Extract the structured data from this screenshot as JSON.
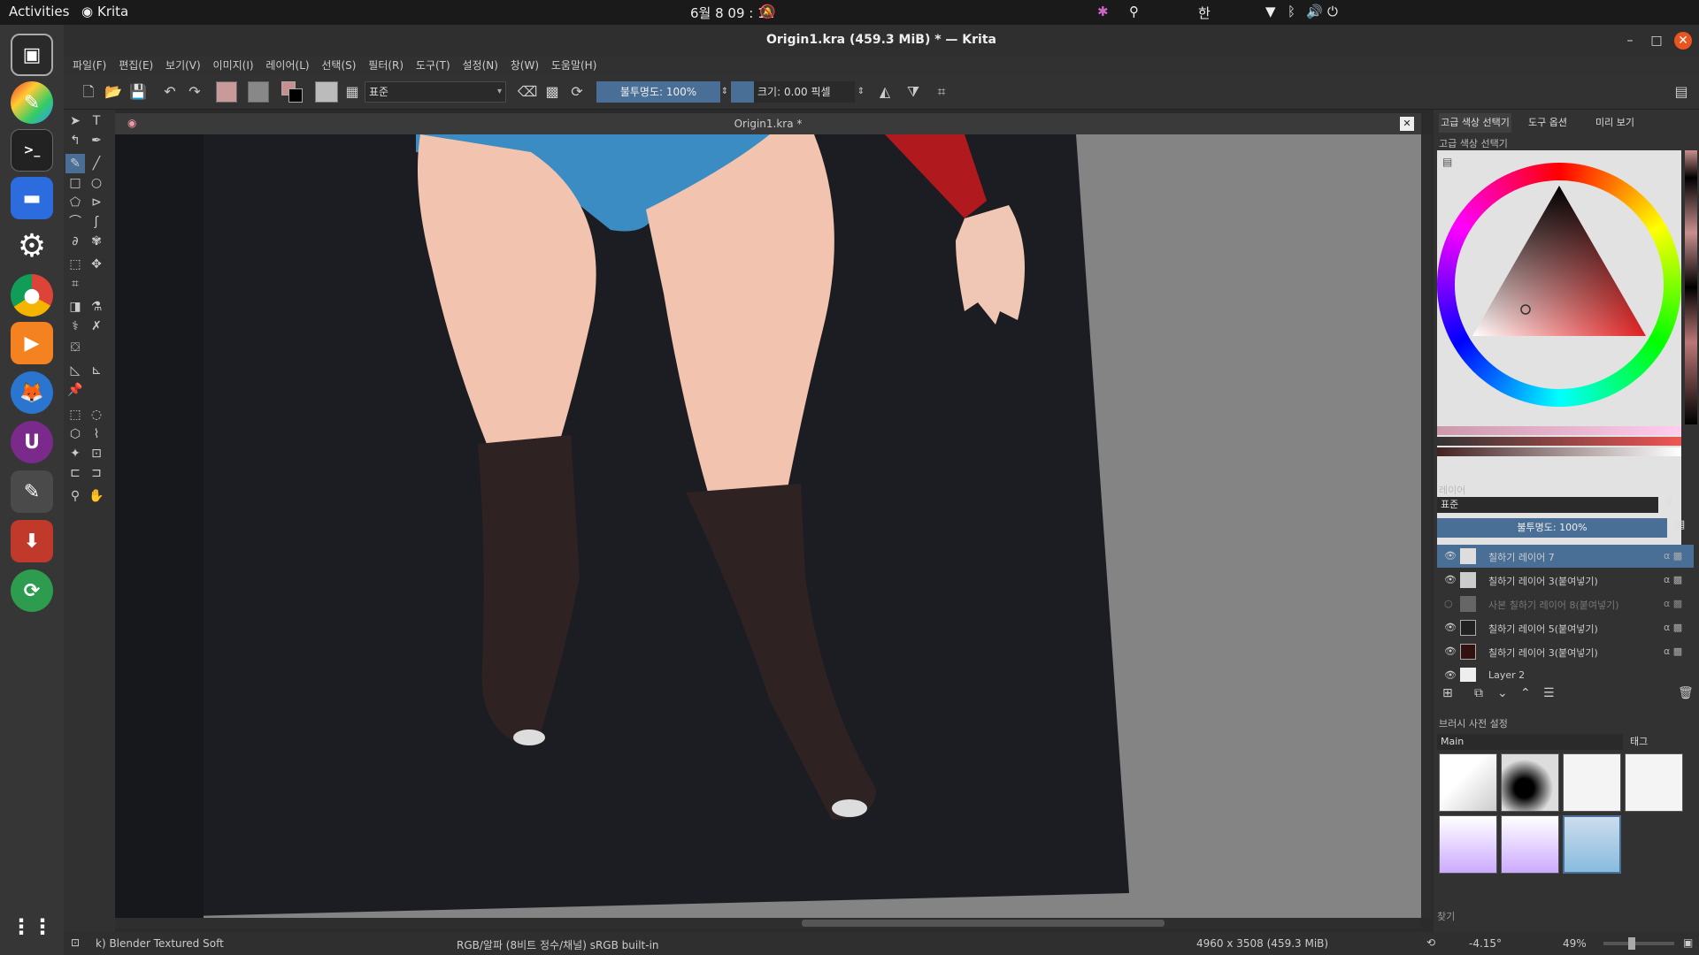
{
  "topbar": {
    "activities": "Activities",
    "app": "Krita",
    "clock": "6월 8  09 : 11",
    "ime": "한"
  },
  "window": {
    "title": "Origin1.kra (459.3 MiB)  * — Krita"
  },
  "menu": [
    "파일(F)",
    "편집(E)",
    "보기(V)",
    "이미지(I)",
    "레이어(L)",
    "선택(S)",
    "필터(R)",
    "도구(T)",
    "설정(N)",
    "창(W)",
    "도움말(H)"
  ],
  "toolbar": {
    "blend_mode": "표준",
    "opacity": "불투명도: 100%",
    "size": "크기: 0.00 픽셀"
  },
  "document_tab": "Origin1.kra *",
  "right_tabs": [
    "고급 색상 선택기",
    "도구 옵션",
    "미리 보기"
  ],
  "color_panel": {
    "title": "고급 색상 선택기"
  },
  "layers_panel": {
    "title": "레이어",
    "blend_mode": "표준",
    "opacity": "불투명도: 100%",
    "layers": [
      {
        "name": "칠하기 레이어 7",
        "visible": true,
        "selected": true
      },
      {
        "name": "칠하기 레이어 3(붙여넣기)",
        "visible": true,
        "selected": false
      },
      {
        "name": "사본 칠하기 레이어 8(붙여넣기)",
        "visible": false,
        "selected": false
      },
      {
        "name": "칠하기 레이어 5(붙여넣기)",
        "visible": true,
        "selected": false
      },
      {
        "name": "칠하기 레이어 3(붙여넣기)",
        "visible": true,
        "selected": false
      },
      {
        "name": "Layer 2",
        "visible": true,
        "selected": false
      }
    ]
  },
  "brush_panel": {
    "title": "브러시 사전 설정",
    "tag_set": "Main",
    "tag_label": "태그",
    "search_placeholder": "찾기"
  },
  "status": {
    "brush": "k) Blender Textured Soft",
    "color_space": "RGB/알파 (8비트 정수/채널)  sRGB built-in",
    "dimensions": "4960 x 3508 (459.3 MiB)",
    "rotation": "-4.15°",
    "zoom": "49%"
  },
  "colors": {
    "accent": "#4a6f96",
    "swatch_fg": "#c98f8f"
  }
}
